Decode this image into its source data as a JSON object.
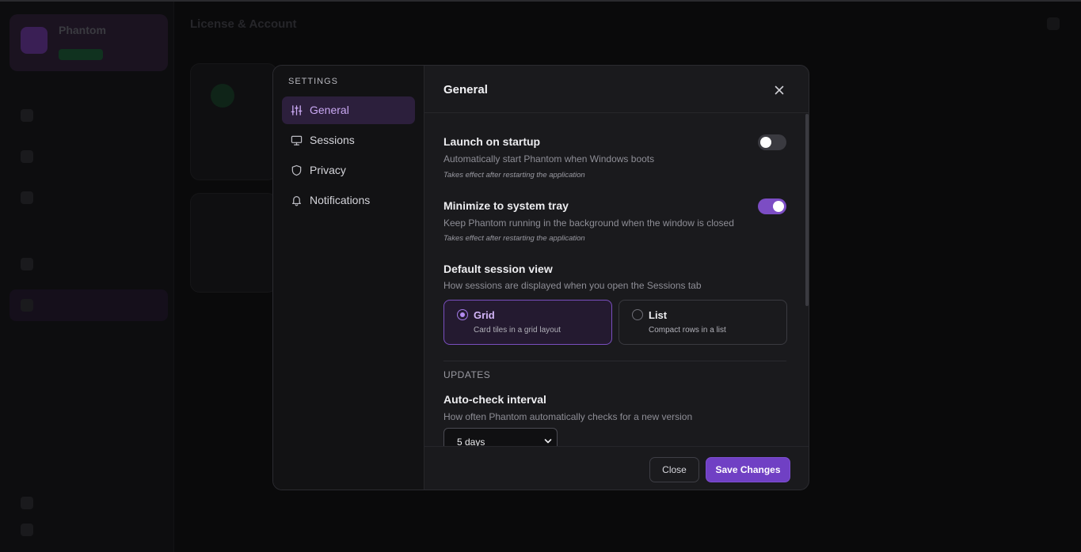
{
  "background": {
    "app_name": "Phantom",
    "page_header": "License & Account"
  },
  "settings": {
    "sidebar_title": "SETTINGS",
    "nav": [
      {
        "label": "General",
        "icon": "sliders-icon",
        "active": true
      },
      {
        "label": "Sessions",
        "icon": "monitor-icon",
        "active": false
      },
      {
        "label": "Privacy",
        "icon": "shield-icon",
        "active": false
      },
      {
        "label": "Notifications",
        "icon": "bell-icon",
        "active": false
      }
    ],
    "title": "General",
    "launch_on_startup": {
      "title": "Launch on startup",
      "description": "Automatically start Phantom when Windows boots",
      "note": "Takes effect after restarting the application",
      "enabled": false
    },
    "minimize_to_tray": {
      "title": "Minimize to system tray",
      "description": "Keep Phantom running in the background when the window is closed",
      "note": "Takes effect after restarting the application",
      "enabled": true
    },
    "default_view": {
      "title": "Default session view",
      "description": "How sessions are displayed when you open the Sessions tab",
      "options": [
        {
          "label": "Grid",
          "description": "Card tiles in a grid layout",
          "selected": true
        },
        {
          "label": "List",
          "description": "Compact rows in a list",
          "selected": false
        }
      ]
    },
    "updates": {
      "section_label": "UPDATES",
      "interval_title": "Auto-check interval",
      "interval_description": "How often Phantom automatically checks for a new version",
      "interval_value": "5 days"
    },
    "footer": {
      "close_label": "Close",
      "save_label": "Save Changes"
    }
  },
  "colors": {
    "accent": "#7040c4",
    "accent_light": "#c9a8f2",
    "modal_bg": "#1a1a1d",
    "sidebar_bg": "#121214"
  }
}
